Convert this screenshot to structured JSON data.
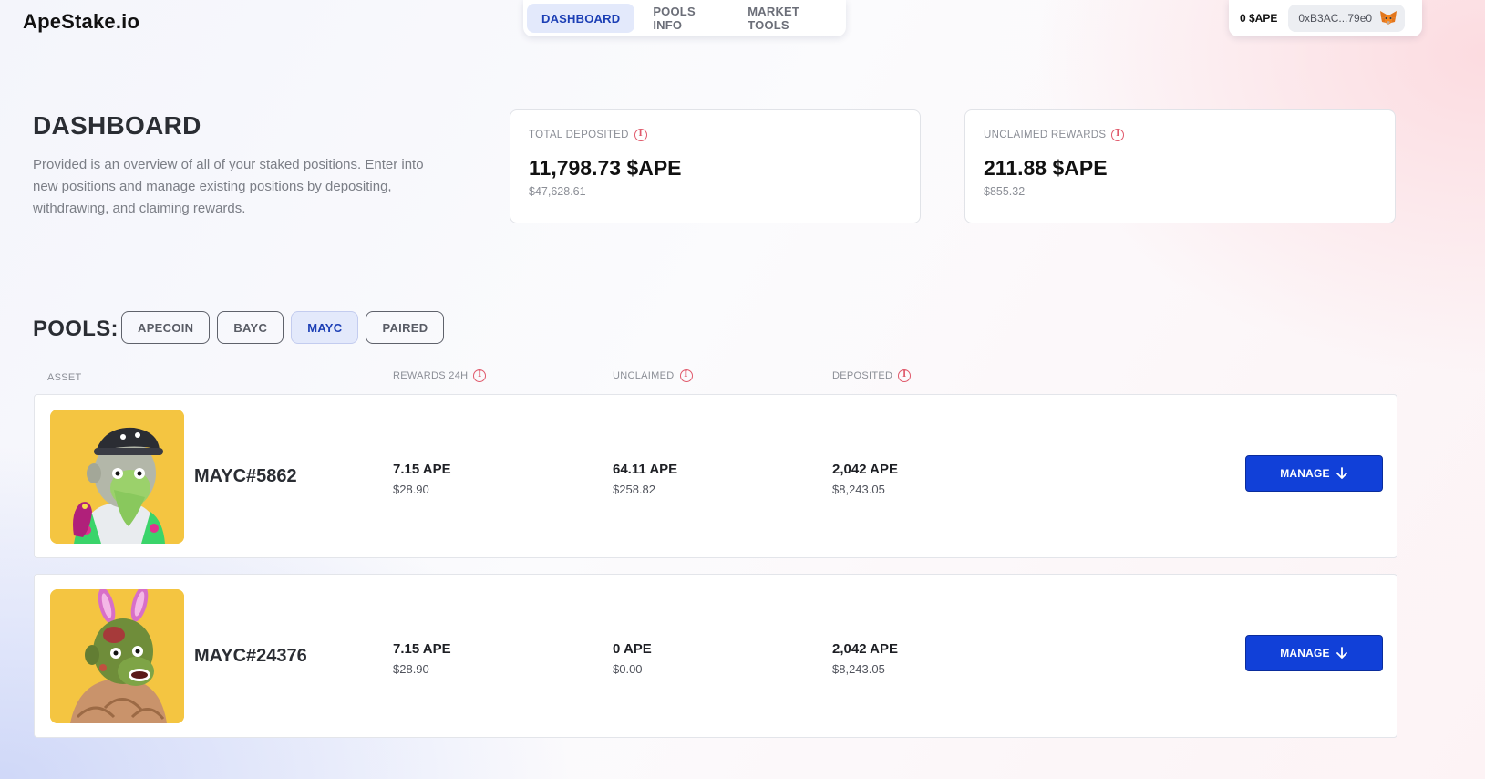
{
  "app": {
    "logo": "ApeStake.io"
  },
  "nav": {
    "tabs": [
      {
        "label": "DASHBOARD",
        "active": true
      },
      {
        "label": "POOLS INFO",
        "active": false
      },
      {
        "label": "MARKET TOOLS",
        "active": false
      }
    ]
  },
  "wallet": {
    "balance": "0 $APE",
    "address": "0xB3AC...79e0",
    "icon": "metamask-fox-icon"
  },
  "header": {
    "title": "DASHBOARD",
    "description": "Provided is an overview of all of your staked positions. Enter into new positions and manage existing positions by depositing, withdrawing, and claiming rewards."
  },
  "stats": {
    "total_deposited": {
      "label": "TOTAL DEPOSITED",
      "value": "11,798.73 $APE",
      "usd": "$47,628.61"
    },
    "unclaimed_rewards": {
      "label": "UNCLAIMED REWARDS",
      "value": "211.88 $APE",
      "usd": "$855.32"
    }
  },
  "pools": {
    "label": "POOLS:",
    "filters": [
      {
        "label": "APECOIN",
        "active": false
      },
      {
        "label": "BAYC",
        "active": false
      },
      {
        "label": "MAYC",
        "active": true
      },
      {
        "label": "PAIRED",
        "active": false
      }
    ]
  },
  "table": {
    "columns": {
      "asset": "ASSET",
      "rewards_24h": "REWARDS 24H",
      "unclaimed": "UNCLAIMED",
      "deposited": "DEPOSITED"
    },
    "rows": [
      {
        "asset": "MAYC#5862",
        "rewards_24h": "7.15 APE",
        "rewards_24h_usd": "$28.90",
        "unclaimed": "64.11 APE",
        "unclaimed_usd": "$258.82",
        "deposited": "2,042 APE",
        "deposited_usd": "$8,243.05",
        "action": "MANAGE"
      },
      {
        "asset": "MAYC#24376",
        "rewards_24h": "7.15 APE",
        "rewards_24h_usd": "$28.90",
        "unclaimed": "0 APE",
        "unclaimed_usd": "$0.00",
        "deposited": "2,042 APE",
        "deposited_usd": "$8,243.05",
        "action": "MANAGE"
      }
    ]
  },
  "colors": {
    "accent": "#1140d8",
    "active_tab_bg": "#e3e9fb",
    "active_tab_text": "#1c3fb5",
    "info_icon": "#e0596b",
    "nft_background": "#f4c541"
  }
}
